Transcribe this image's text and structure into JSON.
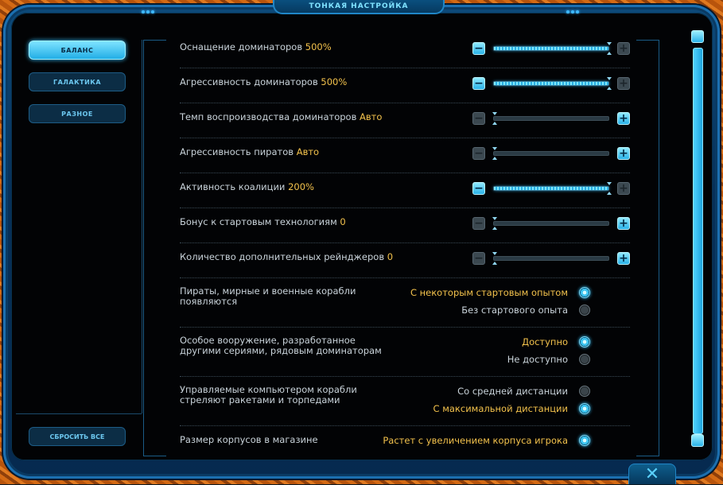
{
  "window": {
    "title": "Тонкая настройка"
  },
  "sidebar": {
    "items": [
      {
        "label": "Баланс",
        "active": true
      },
      {
        "label": "Галактика",
        "active": false
      },
      {
        "label": "Разное",
        "active": false
      }
    ],
    "reset_label": "Сбросить все"
  },
  "settings": {
    "sliders": [
      {
        "label": "Оснащение доминаторов",
        "value": "500%",
        "level": 1.0
      },
      {
        "label": "Агрессивность доминаторов",
        "value": "500%",
        "level": 1.0
      },
      {
        "label": "Темп воспроизводства доминаторов",
        "value": "Авто",
        "level": 0.0
      },
      {
        "label": "Агрессивность пиратов",
        "value": "Авто",
        "level": 0.0
      },
      {
        "label": "Активность коалиции",
        "value": "200%",
        "level": 1.0
      },
      {
        "label": "Бонус к стартовым технологиям",
        "value": "0",
        "level": 0.0
      },
      {
        "label": "Количество дополнительных рейнджеров",
        "value": "0",
        "level": 0.0
      }
    ],
    "radio_groups": [
      {
        "label": "Пираты, мирные и военные корабли появляются",
        "options": [
          {
            "label": "С некоторым стартовым опытом",
            "selected": true
          },
          {
            "label": "Без стартового опыта",
            "selected": false
          }
        ]
      },
      {
        "label": "Особое вооружение, разработанное другими сериями, рядовым доминаторам",
        "options": [
          {
            "label": "Доступно",
            "selected": true
          },
          {
            "label": "Не доступно",
            "selected": false
          }
        ]
      },
      {
        "label": "Управляемые компьютером корабли стреляют ракетами и торпедами",
        "options": [
          {
            "label": "Со средней дистанции",
            "selected": false
          },
          {
            "label": "С максимальной дистанции",
            "selected": true
          }
        ]
      },
      {
        "label": "Размер корпусов в магазине",
        "options": [
          {
            "label": "Растет с увеличением корпуса игрока",
            "selected": true
          }
        ]
      }
    ]
  },
  "icons": {
    "minus": "minus-icon",
    "plus": "plus-icon",
    "close": "close-icon",
    "scroll_up": "scroll-up-icon",
    "scroll_down": "scroll-down-icon"
  },
  "colors": {
    "accent": "#3bc4ff",
    "value_highlight": "#f3c24c",
    "text": "#c9d3da",
    "frame_orange": "#c0600f"
  }
}
